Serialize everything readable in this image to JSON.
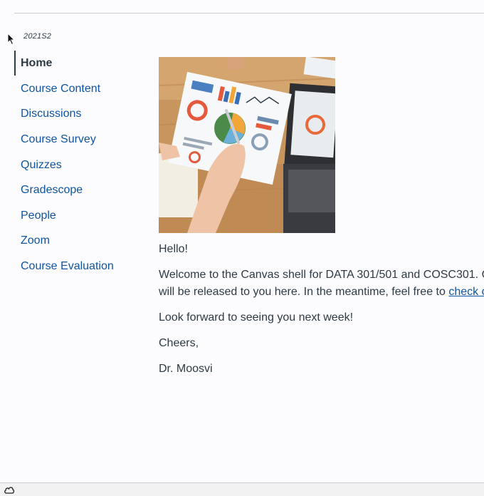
{
  "term": "2021S2",
  "nav": {
    "items": [
      {
        "label": "Home",
        "active": true
      },
      {
        "label": "Course Content"
      },
      {
        "label": "Discussions"
      },
      {
        "label": "Course Survey"
      },
      {
        "label": "Quizzes"
      },
      {
        "label": "Gradescope"
      },
      {
        "label": "People"
      },
      {
        "label": "Zoom"
      },
      {
        "label": "Course Evaluation"
      }
    ]
  },
  "content": {
    "greeting": "Hello!",
    "welcome_line1": "Welcome to the Canvas shell for DATA 301/501 and COSC301. C",
    "welcome_line2_prefix": "will be released to you here. In the meantime, feel free to ",
    "welcome_link": "check ou",
    "look_forward": "Look forward to seeing you next week!",
    "cheers": "Cheers,",
    "signature": "Dr. Moosvi"
  },
  "icons": {
    "cursor": "mouse-pointer-icon",
    "status": "cloud-icon"
  }
}
